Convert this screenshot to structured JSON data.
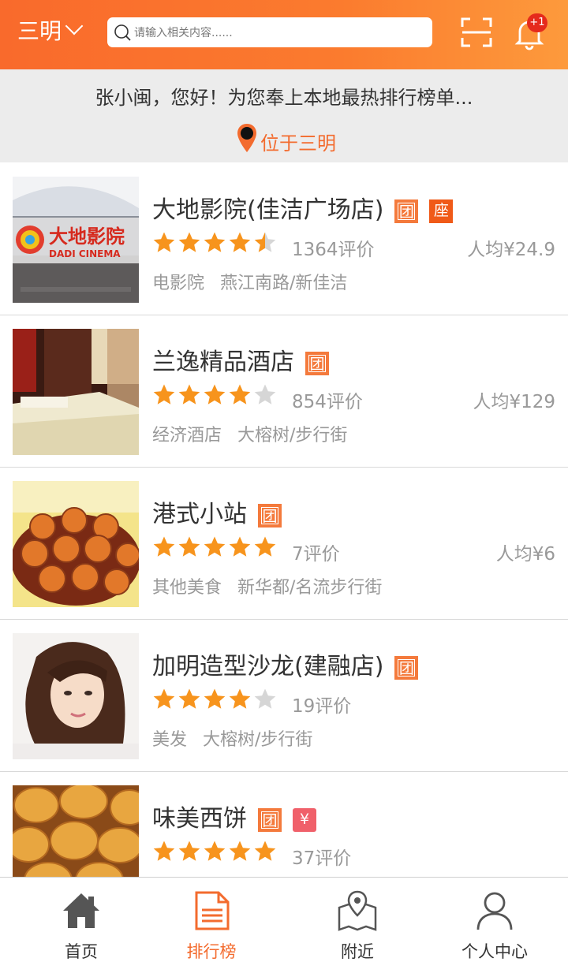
{
  "header": {
    "city": "三明",
    "search_placeholder": "请输入相关内容......",
    "notification_badge": "+1",
    "colors": {
      "accent": "#f96a2c"
    }
  },
  "greeting": {
    "message": "张小闽，您好！为您奉上本地最热排行榜单...",
    "location": "位于三明"
  },
  "list": [
    {
      "name": "大地影院(佳洁广场店)",
      "tags": [
        "团",
        "座"
      ],
      "rating": 4.5,
      "reviews": "1364评价",
      "price": "人均¥24.9",
      "category": "电影院",
      "area": "燕江南路/新佳洁"
    },
    {
      "name": "兰逸精品酒店",
      "tags": [
        "团"
      ],
      "rating": 4.0,
      "reviews": "854评价",
      "price": "人均¥129",
      "category": "经济酒店",
      "area": "大榕树/步行街"
    },
    {
      "name": "港式小站",
      "tags": [
        "团"
      ],
      "rating": 5.0,
      "reviews": "7评价",
      "price": "人均¥6",
      "category": "其他美食",
      "area": "新华都/名流步行街"
    },
    {
      "name": "加明造型沙龙(建融店)",
      "tags": [
        "团"
      ],
      "rating": 4.0,
      "reviews": "19评价",
      "price": "",
      "category": "美发",
      "area": "大榕树/步行街"
    },
    {
      "name": "味美西饼",
      "tags": [
        "团",
        "¥"
      ],
      "rating": 5.0,
      "reviews": "37评价",
      "price": "",
      "category": "",
      "area": ""
    }
  ],
  "cinema_logo_text": "大地影院",
  "cinema_logo_sub": "DADI CINEMA",
  "tabs": [
    {
      "label": "首页",
      "icon": "home-icon",
      "active": false
    },
    {
      "label": "排行榜",
      "icon": "ranking-list-icon",
      "active": true
    },
    {
      "label": "附近",
      "icon": "map-icon",
      "active": false
    },
    {
      "label": "个人中心",
      "icon": "user-icon",
      "active": false
    }
  ]
}
